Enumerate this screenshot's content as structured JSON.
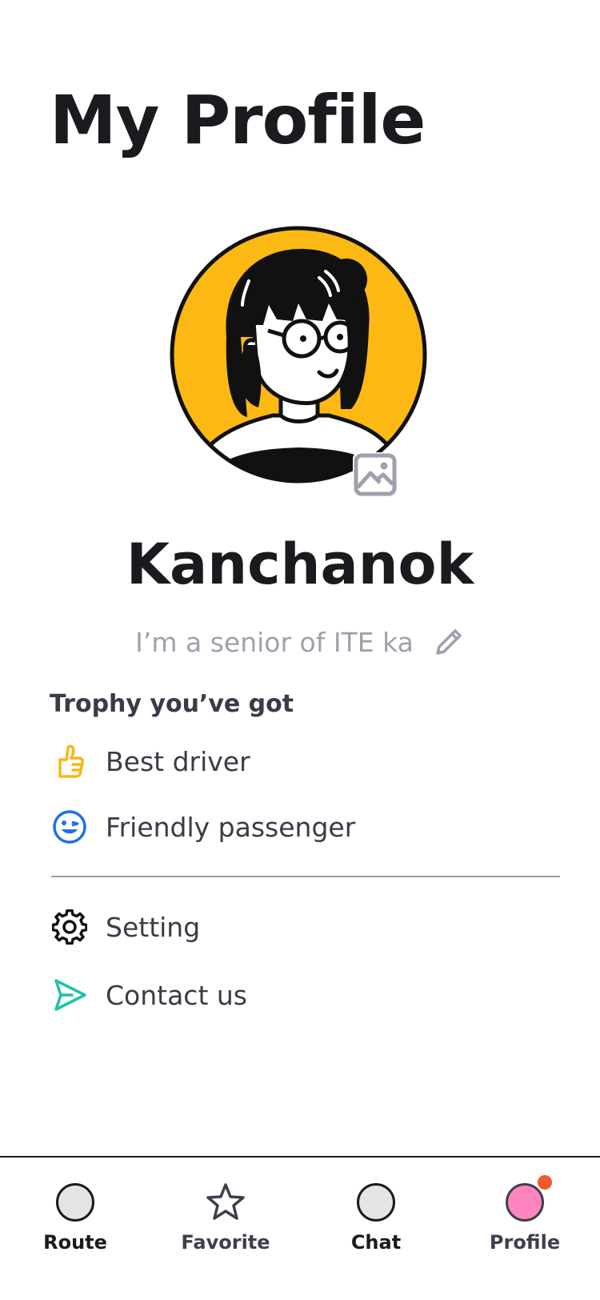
{
  "header": {
    "title": "My Profile"
  },
  "profile": {
    "name": "Kanchanok",
    "bio": "I’m a senior of ITE ka"
  },
  "trophies": {
    "heading": "Trophy you’ve got",
    "items": [
      {
        "label": "Best driver",
        "icon": "thumbs-up-icon",
        "color": "#F5B817"
      },
      {
        "label": "Friendly passenger",
        "icon": "wink-face-icon",
        "color": "#1E6FE8"
      }
    ]
  },
  "menu": {
    "items": [
      {
        "label": "Setting",
        "icon": "gear-icon"
      },
      {
        "label": "Contact us",
        "icon": "send-icon",
        "color": "#1FC2A6"
      }
    ]
  },
  "bottom_nav": {
    "items": [
      {
        "label": "Route",
        "icon": "circle-icon"
      },
      {
        "label": "Favorite",
        "icon": "star-icon"
      },
      {
        "label": "Chat",
        "icon": "circle-icon"
      },
      {
        "label": "Profile",
        "icon": "circle-icon",
        "active": true,
        "badge_color": "#F2582C"
      }
    ]
  },
  "colors": {
    "avatar_bg": "#FDB913",
    "active_nav": "#FF85C0",
    "muted_text": "#9EA1AD"
  }
}
